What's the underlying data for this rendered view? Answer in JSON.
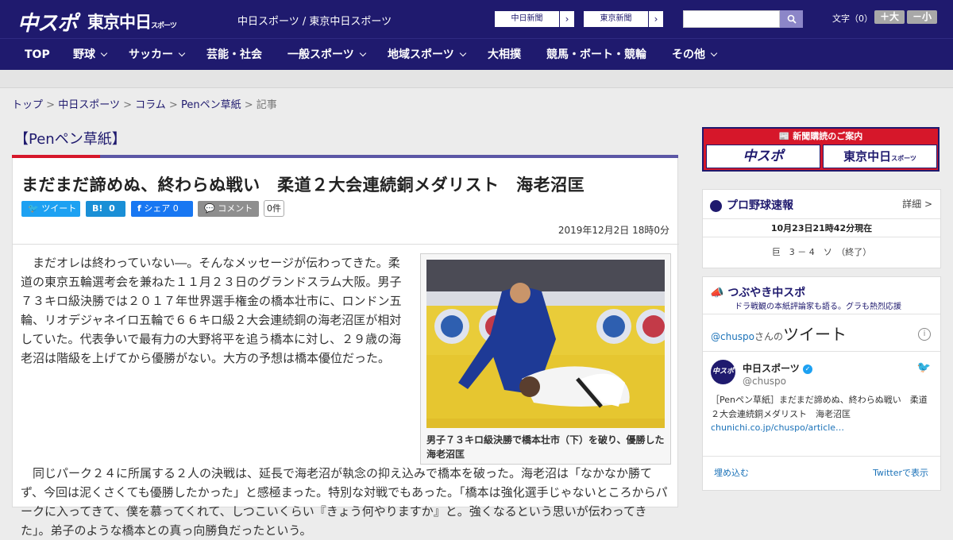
{
  "header": {
    "logo_main": "中スポ",
    "logo_tokyo": "東京中日",
    "logo_tokyo_small": "スポーツ",
    "site_subtitle": "中日スポーツ / 東京中日スポーツ",
    "paper_buttons": [
      "中日新聞",
      "東京新聞"
    ],
    "search_placeholder": "",
    "font_label": "文字（0）",
    "font_bigger": "＋大",
    "font_smaller": "－小"
  },
  "nav": {
    "items": [
      "TOP",
      "野球",
      "サッカー",
      "芸能・社会",
      "一般スポーツ",
      "地域スポーツ",
      "大相撲",
      "競馬・ボート・競輪",
      "その他"
    ]
  },
  "breadcrumb": {
    "links": [
      "トップ",
      "中日スポーツ",
      "コラム",
      "Penペン草紙"
    ],
    "separator": ">",
    "current": "記事"
  },
  "section": {
    "title": "【Penペン草紙】"
  },
  "article": {
    "headline": "まだまだ諦めぬ、終わらぬ戦い　柔道２大会連続銅メダリスト　海老沼匡",
    "share": {
      "tweet": "ツイート",
      "hatena": "B!",
      "hatena_count": "0",
      "facebook": "シェア",
      "facebook_count": "0",
      "comment": "コメント",
      "comment_count": "0件"
    },
    "date": "2019年12月2日 18時0分",
    "paragraph1": "まだオレは終わっていない―。そんなメッセージが伝わってきた。柔道の東京五輪選考会を兼ねた１１月２３日のグランドスラム大阪。男子７３キロ級決勝では２０１７年世界選手権金の橋本壮市に、ロンドン五輪、リオデジャネイロ五輪で６６キロ級２大会連続銅の海老沼匡が相対していた。代表争いで最有力の大野将平を追う橋本に対し、２９歳の海老沼は階級を上げてから優勝がない。大方の予想は橋本優位だった。",
    "paragraph2": "同じパーク２４に所属する２人の決戦は、延長で海老沼が執念の抑え込みで橋本を破った。海老沼は「なかなか勝てず、今回は泥くさくても優勝したかった」と感極まった。特別な対戦でもあった。「橋本は強化選手じゃないところからパークに入ってきて、僕を慕ってくれて、しつこいくらい『きょう何やりますか』と。強くなるという思いが伝わってきた」。弟子のような橋本との真っ向勝負だったという。",
    "photo_caption": "男子７３キロ級決勝で橋本壮市（下）を破り、優勝した海老沼匡"
  },
  "sidebar": {
    "subscribe_title": "新聞購読のご案内",
    "subscribe_left": "中スポ",
    "subscribe_right": "東京中日",
    "subscribe_right_small": "スポーツ",
    "baseball": {
      "title": "プロ野球速報",
      "detail": "詳細 >",
      "updated": "10月23日21時42分現在",
      "score": "巨　3 － 4　ソ　（終了）"
    },
    "tweets": {
      "title": "つぶやき中スポ",
      "subtitle": "ドラ戦観の本紙評論家も語る。グラも熱烈応援",
      "handle_link": "@chuspo",
      "handle_suffix": "さんの",
      "tweet_word": "ツイート",
      "author": "中日スポーツ",
      "author_handle": "@chuspo",
      "text": "［Penペン草紙］まだまだ諦めぬ、終わらぬ戦い　柔道２大会連続銅メダリスト　海老沼匡",
      "link": "chunichi.co.jp/chuspo/article…",
      "embed": "埋め込む",
      "view_on_twitter": "Twitterで表示"
    }
  },
  "colors": {
    "navy": "#1f1a6e",
    "red": "#d6172a",
    "twitter": "#1da1f2"
  }
}
